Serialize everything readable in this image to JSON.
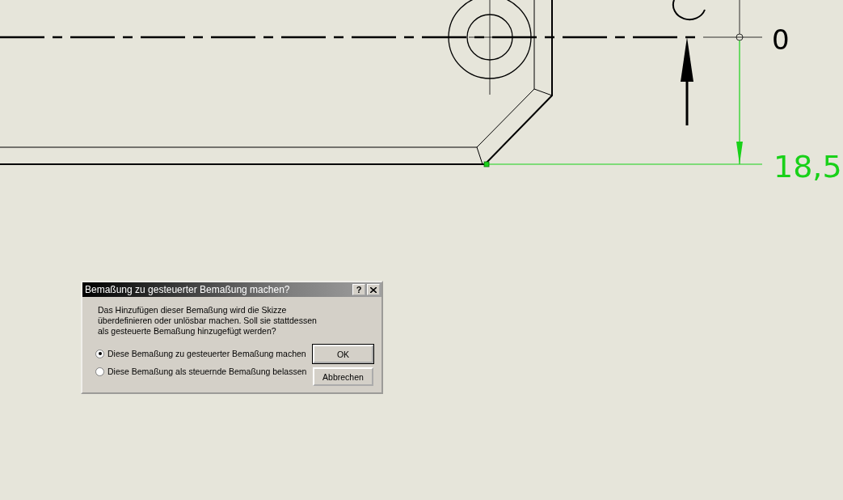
{
  "drawing": {
    "dimension_labels": [
      {
        "text": "0",
        "kind": "reference"
      },
      {
        "text": "18,5",
        "kind": "driven"
      }
    ]
  },
  "dialog": {
    "title": "Bemaßung zu gesteuerter Bemaßung machen?",
    "help_button": "?",
    "message": "Das Hinzufügen dieser Bemaßung wird die Skizze\nüberdefinieren oder unlösbar machen.  Soll sie stattdessen\nals gesteuerte Bemaßung hinzugefügt werden?",
    "options": [
      {
        "label": "Diese Bemaßung zu gesteuerter Bemaßung machen",
        "selected": true
      },
      {
        "label": "Diese Bemaßung als steuernde Bemaßung belassen",
        "selected": false
      }
    ],
    "buttons": [
      "OK",
      "Abbrechen"
    ]
  }
}
